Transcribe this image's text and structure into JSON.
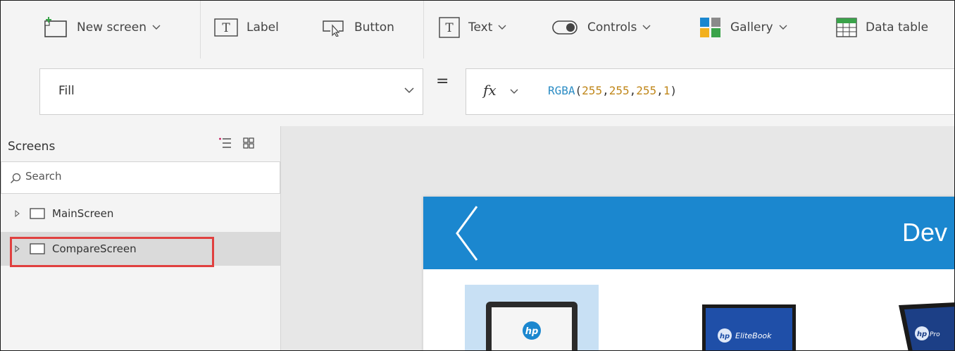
{
  "ribbon": {
    "new_screen": "New screen",
    "label": "Label",
    "button": "Button",
    "text": "Text",
    "controls": "Controls",
    "gallery": "Gallery",
    "data_table": "Data table"
  },
  "formula_bar": {
    "property": "Fill",
    "equals": "=",
    "fx": "fx",
    "formula": {
      "fn": "RGBA",
      "open": "(",
      "args": [
        "255",
        "255",
        "255",
        "1"
      ],
      "sep": ",",
      "close": ")"
    }
  },
  "tree": {
    "title": "Screens",
    "search_placeholder": "Search",
    "items": [
      {
        "label": "MainScreen",
        "selected": false
      },
      {
        "label": "CompareScreen",
        "selected": true
      }
    ]
  },
  "app_preview": {
    "title_partial": "Dev",
    "product_labels": [
      "hp",
      "EliteBook",
      "Pro"
    ]
  },
  "colors": {
    "header_blue": "#1b87cf",
    "highlight_red": "#e0403f",
    "selected_item_bg": "#c8e0f4",
    "formula_fn": "#2b8cc4",
    "formula_num": "#c0871a"
  }
}
